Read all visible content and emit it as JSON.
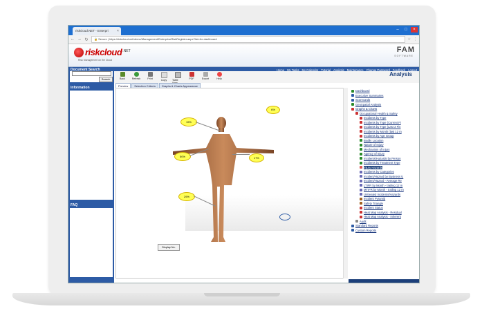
{
  "browser": {
    "tab_title": "riskcloud.NET - Enterpri",
    "tab_close": "×",
    "url_prefix": "Secure",
    "url": "https://riskcloud.net/demo/Management/EnterpriseRiskRegister.aspx?list=fcr-dashboard"
  },
  "app": {
    "logo_text": "riskcloud",
    "logo_net": ".NET",
    "logo_tagline": "Risk Management on the Cloud",
    "partner_logo": "FAM",
    "partner_sub": "SOFTWARE",
    "page_title": "Analysis"
  },
  "toplinks": [
    "Home",
    "My Tasks",
    "My Calendar",
    "Tutorial",
    "Analysis",
    "Maintenance",
    "Change Password",
    "Feedback",
    "Logout"
  ],
  "left": {
    "doc_search_title": "Document Search",
    "search_button": "Search",
    "information_title": "Information",
    "faq_title": "FAQ"
  },
  "toolbar": [
    "Back",
    "Refresh",
    "Print",
    "Copy",
    "Table View",
    "PDF",
    "Export",
    "Help"
  ],
  "tabs": [
    "Preview",
    "Selection Criteria",
    "Graphs & Charts Appearance"
  ],
  "bubbles": [
    "6%",
    "19%",
    "50%",
    "17%",
    "29%"
  ],
  "display_button": "Display No.",
  "tree": [
    "Dashboard",
    "Executive Summaries",
    "Scorecards",
    "GeoSpatial Analysis",
    "Graphs & Charts",
    "Occupational Health & Safety",
    "Incidents by Type",
    "Incidents by Type (Current Fi",
    "Incidents by Type (Last 3 Fin",
    "Incidents by Month (last 12 m",
    "Incidents by Age Group",
    "Bodily Location",
    "Nature of Injury",
    "Mechanism of Injury",
    "Agency of Injury",
    "Incidents/Hazards by Person",
    "Incidents by Treatment Type",
    "Injury Hazards",
    "Incidents by Categories",
    "Incident/Hazard by Business U",
    "Incident/Hazard - Average Re",
    "LTIFR by Month - trailing 12 m",
    "MTIFR by Month - trailing 12 m",
    "Untreated Incidents/Hazards",
    "Incident Pyramid",
    "Safety Triangle",
    "Incident Status",
    "Heat Map Analysis - Residual",
    "Heat Map Analysis - Inherent",
    "Audit",
    "Standard Reports",
    "Custom Reports"
  ]
}
